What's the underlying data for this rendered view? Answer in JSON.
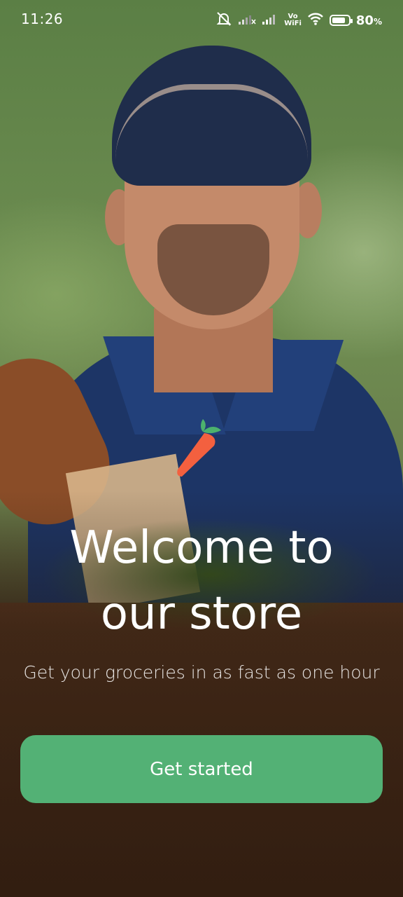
{
  "status_bar": {
    "time": "11:26",
    "battery_percent": "80",
    "battery_unit": "%",
    "battery_level": 0.8,
    "vowifi_top": "Vo",
    "vowifi_bottom": "WiFi",
    "icons": [
      "bell-muted-icon",
      "signal-1-icon",
      "signal-2-icon",
      "vowifi-icon",
      "wifi-icon",
      "battery-icon"
    ]
  },
  "hero": {
    "image": "delivery-man-with-grocery-bag-photo",
    "logo": "carrot-logo-icon"
  },
  "welcome": {
    "title_line1": "Welcome to",
    "title_line2": "our store",
    "subtitle": "Get your groceries in as fast as one hour"
  },
  "actions": {
    "get_started_label": "Get started"
  },
  "colors": {
    "accent": "#53b175",
    "carrot": "#f3603f",
    "leaf": "#4cb26d"
  }
}
